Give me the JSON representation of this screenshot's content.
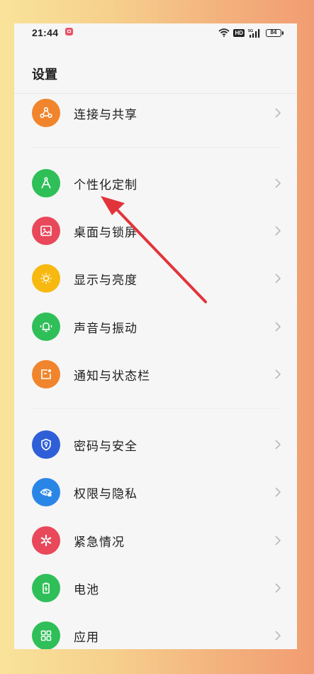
{
  "status_bar": {
    "time": "21:44",
    "battery": "84",
    "network": "5G",
    "hd": "HD"
  },
  "page": {
    "title": "设置"
  },
  "colors": {
    "orange": "#f0852d",
    "green": "#2fbf58",
    "red": "#e8485a",
    "yellow": "#f7b90f",
    "blue": "#2f5fd8",
    "lightblue": "#2a86e6",
    "arrow": "#e2343b"
  },
  "groups": [
    {
      "items": [
        {
          "label": "连接与共享",
          "icon": "share-nodes-icon"
        }
      ]
    },
    {
      "items": [
        {
          "label": "个性化定制",
          "icon": "compass-icon"
        },
        {
          "label": "桌面与锁屏",
          "icon": "image-icon"
        },
        {
          "label": "显示与亮度",
          "icon": "sun-icon"
        },
        {
          "label": "声音与振动",
          "icon": "bell-icon"
        },
        {
          "label": "通知与状态栏",
          "icon": "notification-icon"
        }
      ]
    },
    {
      "items": [
        {
          "label": "密码与安全",
          "icon": "shield-key-icon"
        },
        {
          "label": "权限与隐私",
          "icon": "eye-lock-icon"
        },
        {
          "label": "紧急情况",
          "icon": "asterisk-icon"
        },
        {
          "label": "电池",
          "icon": "battery-icon"
        },
        {
          "label": "应用",
          "icon": "apps-grid-icon"
        }
      ]
    }
  ]
}
